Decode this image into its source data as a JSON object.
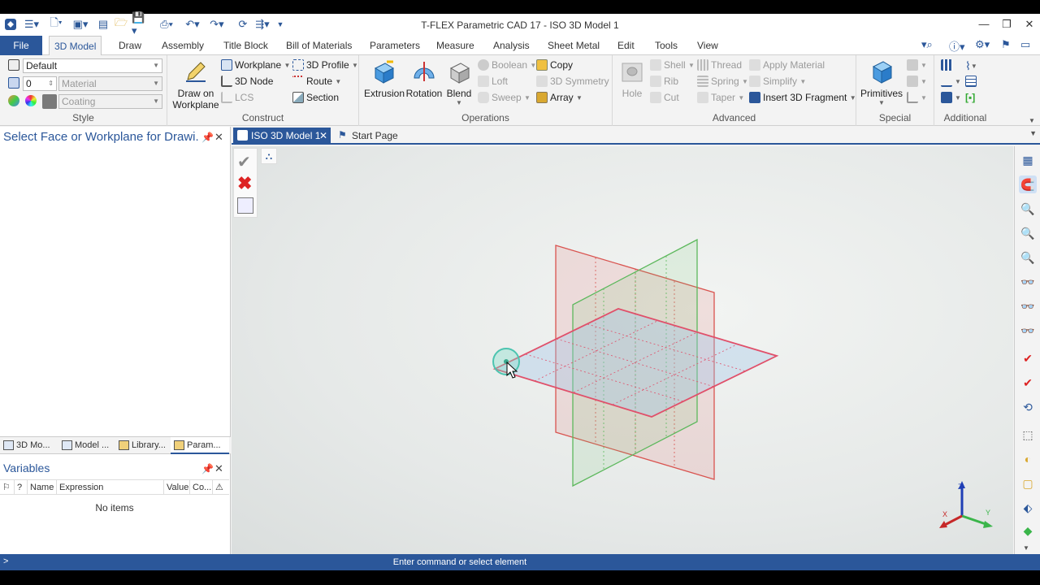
{
  "window": {
    "title": "T-FLEX Parametric CAD 17 - ISO 3D Model 1"
  },
  "menu": {
    "file": "File",
    "tabs": [
      "3D Model",
      "Draw",
      "Assembly",
      "Title Block",
      "Bill of Materials",
      "Parameters",
      "Measure",
      "Analysis",
      "Sheet Metal",
      "Edit",
      "Tools",
      "View"
    ]
  },
  "ribbon": {
    "style": {
      "label": "Style",
      "layer_value": "Default",
      "level_value": "0",
      "material_placeholder": "Material",
      "coating_placeholder": "Coating"
    },
    "construct": {
      "label": "Construct",
      "draw_on_workplane_line1": "Draw on",
      "draw_on_workplane_line2": "Workplane",
      "workplane": "Workplane",
      "node": "3D Node",
      "lcs": "LCS",
      "profile": "3D Profile",
      "route": "Route",
      "section": "Section"
    },
    "operations": {
      "label": "Operations",
      "extrusion": "Extrusion",
      "rotation": "Rotation",
      "blend": "Blend",
      "boolean": "Boolean",
      "loft": "Loft",
      "sweep": "Sweep",
      "copy": "Copy",
      "symmetry": "3D Symmetry",
      "array": "Array"
    },
    "advanced": {
      "label": "Advanced",
      "hole": "Hole",
      "shell": "Shell",
      "rib": "Rib",
      "cut": "Cut",
      "thread": "Thread",
      "spring": "Spring",
      "taper": "Taper",
      "apply_material": "Apply Material",
      "simplify": "Simplify",
      "insert_fragment": "Insert 3D Fragment"
    },
    "special": {
      "label": "Special",
      "primitives": "Primitives"
    },
    "additional": {
      "label": "Additional"
    }
  },
  "left_panel": {
    "title": "Select Face or Workplane for Drawi...",
    "tabs": [
      "3D Mo...",
      "Model ...",
      "Library...",
      "Param..."
    ],
    "variables": {
      "title": "Variables",
      "columns": [
        "?",
        "Name",
        "Expression",
        "Value",
        "Co..."
      ],
      "empty": "No items"
    }
  },
  "doc_tabs": [
    "ISO 3D Model 1",
    "Start Page"
  ],
  "axes": {
    "x": "X",
    "y": "Y",
    "z": "Z"
  },
  "status": {
    "prompt": ">",
    "text": "Enter command or select element"
  },
  "colors": {
    "accent": "#2b579a",
    "plane_red": "#d9534f",
    "plane_green": "#5cb85c",
    "plane_blue": "#9fc3e7"
  }
}
